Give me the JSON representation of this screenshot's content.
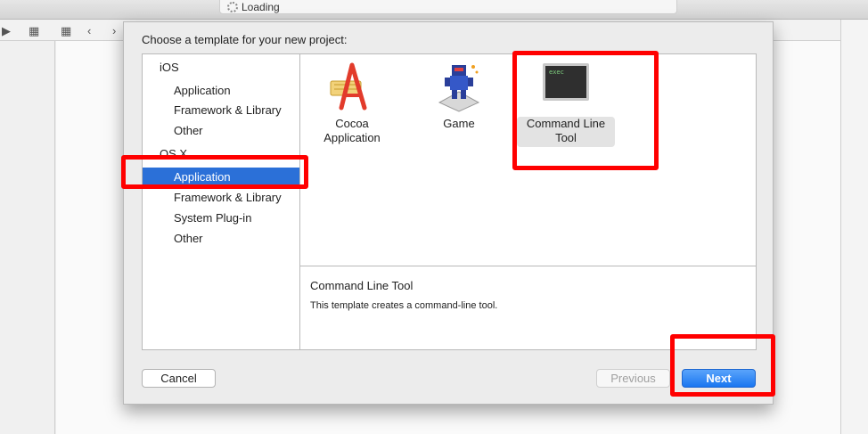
{
  "status": {
    "text": "Loading"
  },
  "dialog": {
    "heading": "Choose a template for your new project:",
    "sidebar": {
      "groups": [
        {
          "label": "iOS",
          "items": [
            "Application",
            "Framework & Library",
            "Other"
          ]
        },
        {
          "label": "OS X",
          "items": [
            "Application",
            "Framework & Library",
            "System Plug-in",
            "Other"
          ]
        }
      ],
      "selected": "OS X / Application"
    },
    "templates": [
      {
        "label1": "Cocoa",
        "label2": "Application",
        "icon": "cocoa-app-icon"
      },
      {
        "label1": "Game",
        "label2": "",
        "icon": "game-icon"
      },
      {
        "label1": "Command Line",
        "label2": "Tool",
        "icon": "terminal-icon",
        "selected": true
      }
    ],
    "terminal_text": "exec",
    "description": {
      "title": "Command Line Tool",
      "text": "This template creates a command-line tool."
    },
    "buttons": {
      "cancel": "Cancel",
      "previous": "Previous",
      "next": "Next"
    }
  },
  "colors": {
    "selection": "#2b70d8",
    "highlight": "#ff0000",
    "primary_button": "#1a76f0"
  }
}
